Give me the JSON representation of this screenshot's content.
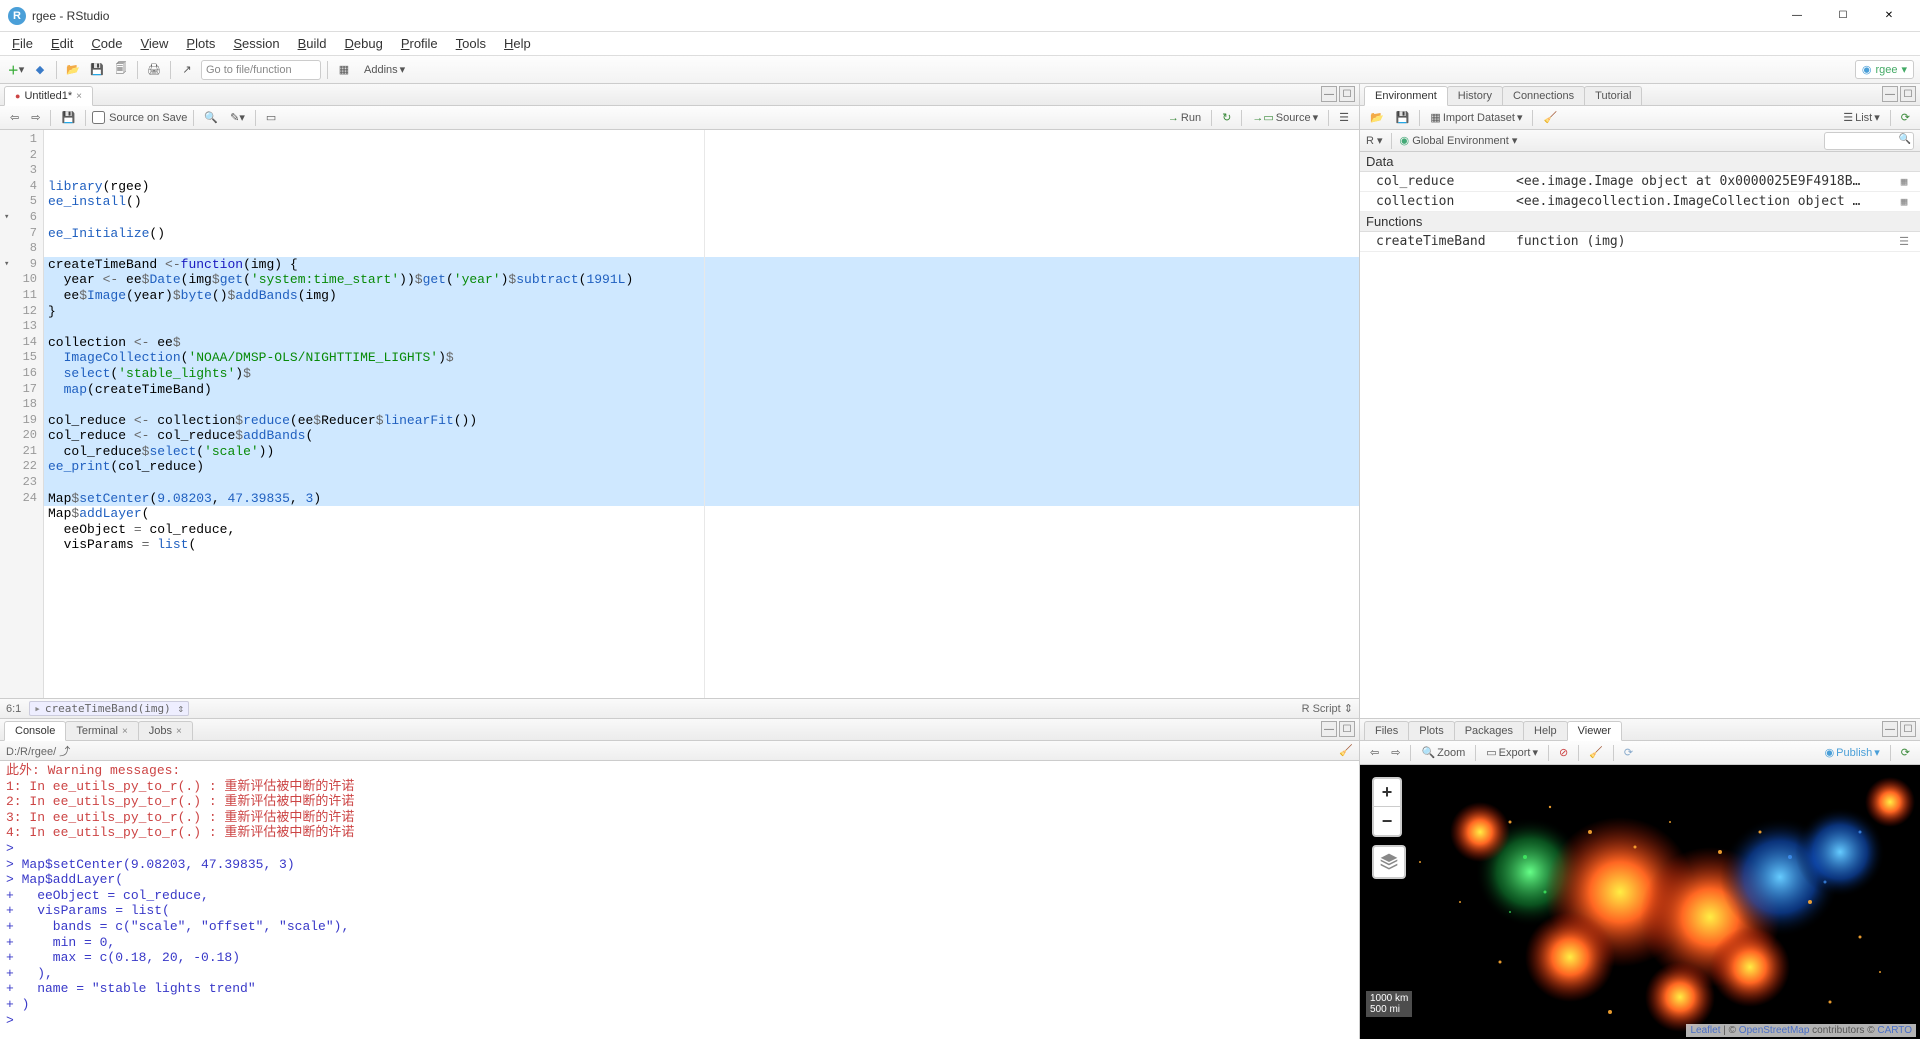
{
  "window": {
    "title": "rgee - RStudio"
  },
  "menubar": [
    {
      "label": "File",
      "u": 0
    },
    {
      "label": "Edit",
      "u": 0
    },
    {
      "label": "Code",
      "u": 0
    },
    {
      "label": "View",
      "u": 0
    },
    {
      "label": "Plots",
      "u": 0
    },
    {
      "label": "Session",
      "u": 0
    },
    {
      "label": "Build",
      "u": 0
    },
    {
      "label": "Debug",
      "u": 0
    },
    {
      "label": "Profile",
      "u": 0
    },
    {
      "label": "Tools",
      "u": 0
    },
    {
      "label": "Help",
      "u": 0
    }
  ],
  "toolbar": {
    "goto_placeholder": "Go to file/function",
    "addins_label": "Addins",
    "project_label": "rgee"
  },
  "source_pane": {
    "tab_name": "Untitled1*",
    "source_on_save": "Source on Save",
    "run_label": "Run",
    "source_label": "Source",
    "status_pos": "6:1",
    "status_func": "createTimeBand(img)",
    "status_type": "R Script",
    "code_lines": [
      {
        "n": 1,
        "hl": false,
        "segs": [
          [
            "library",
            "c-blue"
          ],
          [
            "(rgee)",
            ""
          ]
        ]
      },
      {
        "n": 2,
        "hl": false,
        "segs": [
          [
            "ee_install",
            "c-blue"
          ],
          [
            "()",
            ""
          ]
        ]
      },
      {
        "n": 3,
        "hl": false,
        "segs": [
          [
            "",
            ""
          ]
        ]
      },
      {
        "n": 4,
        "hl": false,
        "segs": [
          [
            "ee_Initialize",
            "c-blue"
          ],
          [
            "()",
            ""
          ]
        ]
      },
      {
        "n": 5,
        "hl": false,
        "segs": [
          [
            "",
            ""
          ]
        ]
      },
      {
        "n": 6,
        "hl": true,
        "fold": true,
        "segs": [
          [
            "createTimeBand ",
            ""
          ],
          [
            "<-",
            "c-op"
          ],
          [
            "function",
            "c-kw"
          ],
          [
            "(img) {",
            ""
          ]
        ]
      },
      {
        "n": 7,
        "hl": true,
        "segs": [
          [
            "  year ",
            ""
          ],
          [
            "<-",
            "c-op"
          ],
          [
            " ee",
            ""
          ],
          [
            "$",
            "c-op"
          ],
          [
            "Date",
            "c-blue"
          ],
          [
            "(img",
            ""
          ],
          [
            "$",
            "c-op"
          ],
          [
            "get",
            "c-blue"
          ],
          [
            "(",
            ""
          ],
          [
            "'system:time_start'",
            "c-str"
          ],
          [
            "))",
            ""
          ],
          [
            "$",
            "c-op"
          ],
          [
            "get",
            "c-blue"
          ],
          [
            "(",
            ""
          ],
          [
            "'year'",
            "c-str"
          ],
          [
            ")",
            ""
          ],
          [
            "$",
            "c-op"
          ],
          [
            "subtract",
            "c-blue"
          ],
          [
            "(",
            ""
          ],
          [
            "1991L",
            "c-num"
          ],
          [
            ")",
            ""
          ]
        ]
      },
      {
        "n": 8,
        "hl": true,
        "segs": [
          [
            "  ee",
            ""
          ],
          [
            "$",
            "c-op"
          ],
          [
            "Image",
            "c-blue"
          ],
          [
            "(year)",
            ""
          ],
          [
            "$",
            "c-op"
          ],
          [
            "byte",
            "c-blue"
          ],
          [
            "()",
            ""
          ],
          [
            "$",
            "c-op"
          ],
          [
            "addBands",
            "c-blue"
          ],
          [
            "(img)",
            ""
          ]
        ]
      },
      {
        "n": 9,
        "hl": true,
        "fold": true,
        "segs": [
          [
            "}",
            ""
          ]
        ]
      },
      {
        "n": 10,
        "hl": true,
        "segs": [
          [
            "",
            ""
          ]
        ]
      },
      {
        "n": 11,
        "hl": true,
        "segs": [
          [
            "collection ",
            ""
          ],
          [
            "<-",
            "c-op"
          ],
          [
            " ee",
            ""
          ],
          [
            "$",
            "c-op"
          ],
          [
            " ",
            ""
          ]
        ]
      },
      {
        "n": 12,
        "hl": true,
        "segs": [
          [
            "  ",
            ""
          ],
          [
            "ImageCollection",
            "c-blue"
          ],
          [
            "(",
            ""
          ],
          [
            "'NOAA/DMSP-OLS/NIGHTTIME_LIGHTS'",
            "c-str"
          ],
          [
            ")",
            ""
          ],
          [
            "$",
            "c-op"
          ]
        ]
      },
      {
        "n": 13,
        "hl": true,
        "segs": [
          [
            "  ",
            ""
          ],
          [
            "select",
            "c-blue"
          ],
          [
            "(",
            ""
          ],
          [
            "'stable_lights'",
            "c-str"
          ],
          [
            ")",
            ""
          ],
          [
            "$",
            "c-op"
          ]
        ]
      },
      {
        "n": 14,
        "hl": true,
        "segs": [
          [
            "  ",
            ""
          ],
          [
            "map",
            "c-blue"
          ],
          [
            "(createTimeBand)",
            ""
          ]
        ]
      },
      {
        "n": 15,
        "hl": true,
        "segs": [
          [
            "",
            ""
          ]
        ]
      },
      {
        "n": 16,
        "hl": true,
        "segs": [
          [
            "col_reduce ",
            ""
          ],
          [
            "<-",
            "c-op"
          ],
          [
            " collection",
            ""
          ],
          [
            "$",
            "c-op"
          ],
          [
            "reduce",
            "c-blue"
          ],
          [
            "(ee",
            ""
          ],
          [
            "$",
            "c-op"
          ],
          [
            "Reducer",
            ""
          ],
          [
            "$",
            "c-op"
          ],
          [
            "linearFit",
            "c-blue"
          ],
          [
            "())",
            ""
          ]
        ]
      },
      {
        "n": 17,
        "hl": true,
        "segs": [
          [
            "col_reduce ",
            ""
          ],
          [
            "<-",
            "c-op"
          ],
          [
            " col_reduce",
            ""
          ],
          [
            "$",
            "c-op"
          ],
          [
            "addBands",
            "c-blue"
          ],
          [
            "(",
            ""
          ]
        ]
      },
      {
        "n": 18,
        "hl": true,
        "segs": [
          [
            "  col_reduce",
            ""
          ],
          [
            "$",
            "c-op"
          ],
          [
            "select",
            "c-blue"
          ],
          [
            "(",
            ""
          ],
          [
            "'scale'",
            "c-str"
          ],
          [
            "))",
            ""
          ]
        ]
      },
      {
        "n": 19,
        "hl": true,
        "segs": [
          [
            "ee_print",
            "c-blue"
          ],
          [
            "(col_reduce)",
            ""
          ]
        ]
      },
      {
        "n": 20,
        "hl": true,
        "segs": [
          [
            "",
            ""
          ]
        ]
      },
      {
        "n": 21,
        "hl": true,
        "segs": [
          [
            "Map",
            ""
          ],
          [
            "$",
            "c-op"
          ],
          [
            "setCenter",
            "c-blue"
          ],
          [
            "(",
            ""
          ],
          [
            "9.08203",
            "c-num"
          ],
          [
            ", ",
            ""
          ],
          [
            "47.39835",
            "c-num"
          ],
          [
            ", ",
            ""
          ],
          [
            "3",
            "c-num"
          ],
          [
            ")",
            ""
          ]
        ]
      },
      {
        "n": 22,
        "hl": false,
        "segs": [
          [
            "Map",
            ""
          ],
          [
            "$",
            "c-op"
          ],
          [
            "addLayer",
            "c-blue"
          ],
          [
            "(",
            ""
          ]
        ]
      },
      {
        "n": 23,
        "hl": false,
        "segs": [
          [
            "  eeObject ",
            ""
          ],
          [
            "=",
            "c-op"
          ],
          [
            " col_reduce,",
            ""
          ]
        ]
      },
      {
        "n": 24,
        "hl": false,
        "segs": [
          [
            "  visParams ",
            ""
          ],
          [
            "=",
            "c-op"
          ],
          [
            " ",
            ""
          ],
          [
            "list",
            "c-blue"
          ],
          [
            "(",
            ""
          ]
        ]
      }
    ]
  },
  "console_pane": {
    "tabs": [
      "Console",
      "Terminal",
      "Jobs"
    ],
    "path": "D:/R/rgee/",
    "lines": [
      {
        "cls": "c-red",
        "txt": "此外: Warning messages:"
      },
      {
        "cls": "c-red",
        "txt": "1: In ee_utils_py_to_r(.) : 重新评估被中断的许诺"
      },
      {
        "cls": "c-red",
        "txt": "2: In ee_utils_py_to_r(.) : 重新评估被中断的许诺"
      },
      {
        "cls": "c-red",
        "txt": "3: In ee_utils_py_to_r(.) : 重新评估被中断的许诺"
      },
      {
        "cls": "c-red",
        "txt": "4: In ee_utils_py_to_r(.) : 重新评估被中断的许诺"
      },
      {
        "cls": "c-cblue",
        "txt": "> "
      },
      {
        "cls": "c-cblue",
        "txt": "> Map$setCenter(9.08203, 47.39835, 3)"
      },
      {
        "cls": "c-cblue",
        "txt": "> Map$addLayer("
      },
      {
        "cls": "c-cblue",
        "txt": "+   eeObject = col_reduce,"
      },
      {
        "cls": "c-cblue",
        "txt": "+   visParams = list("
      },
      {
        "cls": "c-cblue",
        "txt": "+     bands = c(\"scale\", \"offset\", \"scale\"),"
      },
      {
        "cls": "c-cblue",
        "txt": "+     min = 0,"
      },
      {
        "cls": "c-cblue",
        "txt": "+     max = c(0.18, 20, -0.18)"
      },
      {
        "cls": "c-cblue",
        "txt": "+   ),"
      },
      {
        "cls": "c-cblue",
        "txt": "+   name = \"stable lights trend\""
      },
      {
        "cls": "c-cblue",
        "txt": "+ )"
      },
      {
        "cls": "c-cblue",
        "txt": "> "
      }
    ]
  },
  "env_pane": {
    "tabs": [
      "Environment",
      "History",
      "Connections",
      "Tutorial"
    ],
    "import_label": "Import Dataset",
    "list_label": "List",
    "scope_left": "R",
    "scope_right": "Global Environment",
    "sections": [
      {
        "title": "Data",
        "rows": [
          {
            "name": "col_reduce",
            "value": "<ee.image.Image object at 0x0000025E9F4918B…",
            "icon": "▦"
          },
          {
            "name": "collection",
            "value": "<ee.imagecollection.ImageCollection object …",
            "icon": "▦"
          }
        ]
      },
      {
        "title": "Functions",
        "rows": [
          {
            "name": "createTimeBand",
            "value": "function (img)",
            "icon": "☰"
          }
        ]
      }
    ]
  },
  "viewer_pane": {
    "tabs": [
      "Files",
      "Plots",
      "Packages",
      "Help",
      "Viewer"
    ],
    "zoom_label": "Zoom",
    "export_label": "Export",
    "publish_label": "Publish",
    "scale1": "1000 km",
    "scale2": "500 mi",
    "attrib_leaflet": "Leaflet",
    "attrib_sep": " | © ",
    "attrib_osm": "OpenStreetMap",
    "attrib_mid": " contributors © ",
    "attrib_carto": "CARTO"
  }
}
